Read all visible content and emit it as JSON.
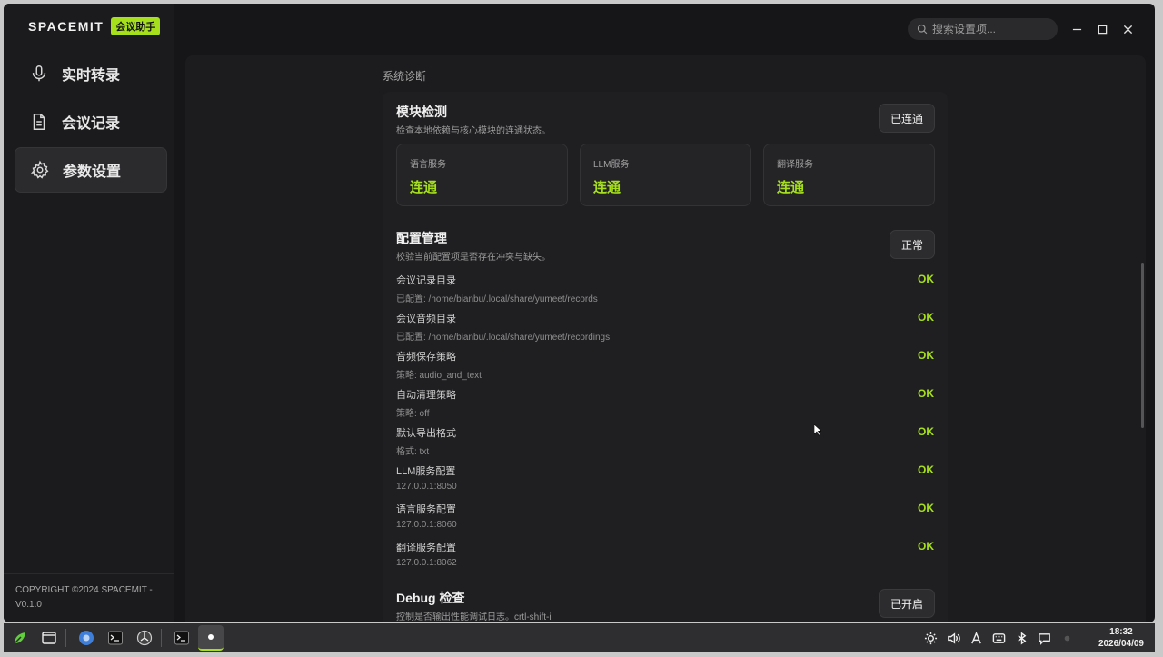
{
  "brand": {
    "name": "SPACEMIT",
    "badge": "会议助手"
  },
  "nav": {
    "items": [
      {
        "label": "实时转录",
        "icon": "microphone-icon"
      },
      {
        "label": "会议记录",
        "icon": "document-icon"
      },
      {
        "label": "参数设置",
        "icon": "gear-icon",
        "active": true
      }
    ]
  },
  "footer": {
    "copyright": "COPYRIGHT ©2024 SPACEMIT -",
    "version": "V0.1.0"
  },
  "search": {
    "placeholder": "搜索设置项..."
  },
  "section_label": "系统诊断",
  "module_check": {
    "title": "模块检测",
    "subtitle": "检查本地依赖与核心模块的连通状态。",
    "button": "已连通",
    "cards": [
      {
        "label": "语言服务",
        "value": "连通"
      },
      {
        "label": "LLM服务",
        "value": "连通"
      },
      {
        "label": "翻译服务",
        "value": "连通"
      }
    ]
  },
  "config": {
    "title": "配置管理",
    "subtitle": "校验当前配置项是否存在冲突与缺失。",
    "button": "正常",
    "rows": [
      {
        "name": "会议记录目录",
        "value": "已配置: /home/bianbu/.local/share/yumeet/records",
        "status": "OK"
      },
      {
        "name": "会议音频目录",
        "value": "已配置: /home/bianbu/.local/share/yumeet/recordings",
        "status": "OK"
      },
      {
        "name": "音频保存策略",
        "value": "策略: audio_and_text",
        "status": "OK"
      },
      {
        "name": "自动清理策略",
        "value": "策略: off",
        "status": "OK"
      },
      {
        "name": "默认导出格式",
        "value": "格式: txt",
        "status": "OK"
      },
      {
        "name": "LLM服务配置",
        "value": "127.0.0.1:8050",
        "status": "OK"
      },
      {
        "name": "语言服务配置",
        "value": "127.0.0.1:8060",
        "status": "OK"
      },
      {
        "name": "翻译服务配置",
        "value": "127.0.0.1:8062",
        "status": "OK"
      }
    ]
  },
  "debug": {
    "title": "Debug 检查",
    "subtitle": "控制是否输出性能调试日志。crtl-shift-i",
    "button": "已开启"
  },
  "clock": {
    "time": "18:32",
    "date": "2026/04/09"
  },
  "colors": {
    "accent": "#a6e01c",
    "background": "#161618"
  }
}
